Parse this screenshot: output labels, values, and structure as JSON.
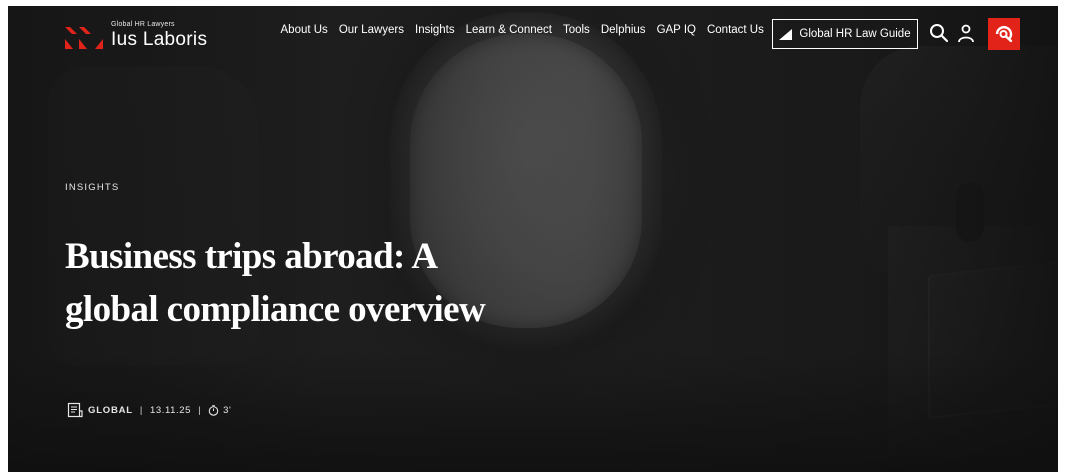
{
  "header": {
    "logo": {
      "tagline": "Global HR Lawyers",
      "name": "Ius Laboris",
      "mark_color": "#e2231a"
    },
    "nav": [
      {
        "label": "About Us"
      },
      {
        "label": "Our Lawyers"
      },
      {
        "label": "Insights"
      },
      {
        "label": "Learn & Connect"
      },
      {
        "label": "Tools"
      },
      {
        "label": "Delphius"
      },
      {
        "label": "GAP IQ"
      },
      {
        "label": "Contact Us"
      }
    ],
    "guide_button": {
      "label": "Global HR Law Guide",
      "icon": "triangle-icon"
    },
    "icons": [
      "search-icon",
      "user-icon",
      "brand-badge-icon"
    ],
    "badge_color": "#e2231a"
  },
  "hero": {
    "category": "INSIGHTS",
    "title": "Business trips abroad: A global compliance overview",
    "meta": {
      "region": "GLOBAL",
      "date": "13.11.25",
      "read_time": "3'",
      "separator": "|"
    }
  },
  "colors": {
    "background": "#1c1c1c",
    "text": "#ffffff",
    "accent": "#e2231a"
  }
}
